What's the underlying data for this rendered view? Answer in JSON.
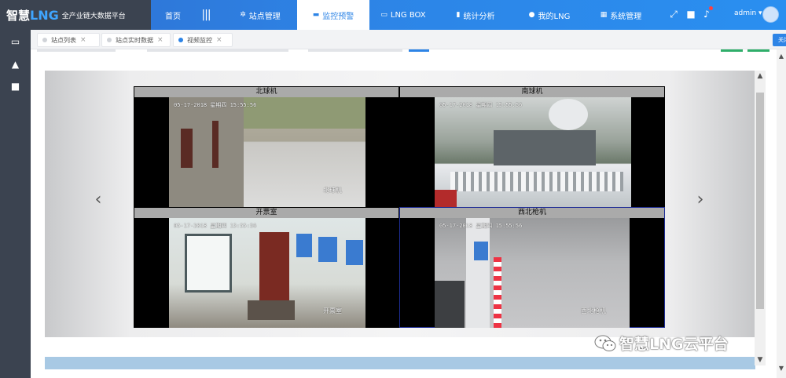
{
  "app": {
    "logo_zh": "智慧",
    "logo_lng": "LNG",
    "logo_sub": "全产业链大数据平台"
  },
  "nav": {
    "items": [
      {
        "label": "首页",
        "icon": ""
      },
      {
        "label": "站点管理",
        "icon": "gear-icon"
      },
      {
        "label": "监控预警",
        "icon": "monitor-icon"
      },
      {
        "label": "LNG BOX",
        "icon": "box-icon"
      },
      {
        "label": "统计分析",
        "icon": "bar-chart-icon"
      },
      {
        "label": "我的LNG",
        "icon": "user-icon"
      },
      {
        "label": "系统管理",
        "icon": "grid-icon"
      }
    ],
    "active": "监控预警"
  },
  "user": {
    "name": "admin ▾"
  },
  "tabs": [
    {
      "label": "站点列表",
      "active": false
    },
    {
      "label": "站点实时数据",
      "active": false
    },
    {
      "label": "视频监控",
      "active": true
    }
  ],
  "close_others": "关闭其他",
  "cameras": [
    {
      "label": "北球机",
      "timestamp": "05-17-2018 星期四 15:55:56",
      "caption": "北球机"
    },
    {
      "label": "南球机",
      "timestamp": "05-17-2018 星期四 15:55:56",
      "caption": ""
    },
    {
      "label": "开票室",
      "timestamp": "05-17-2018 星期四 15:55:56",
      "caption": "开票室"
    },
    {
      "label": "西北枪机",
      "timestamp": "05-17-2018 星期四 15:55:56",
      "caption": "西北枪机"
    }
  ],
  "carousel": {
    "prev": "‹",
    "next": "›"
  },
  "watermark": "智慧LNG云平台",
  "colors": {
    "accent": "#2d84e6",
    "sidebar": "#3b4350",
    "selected_border": "#1e2d96"
  }
}
